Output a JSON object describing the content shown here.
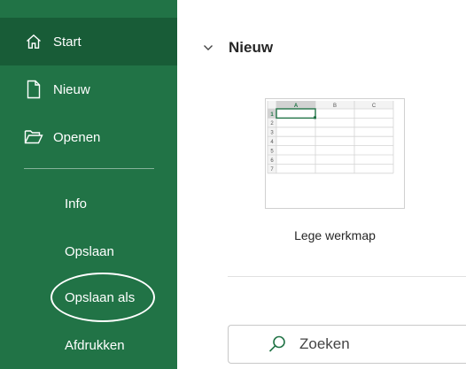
{
  "sidebar": {
    "items": [
      {
        "label": "Start",
        "icon": "home-icon"
      },
      {
        "label": "Nieuw",
        "icon": "new-document-icon"
      },
      {
        "label": "Openen",
        "icon": "open-folder-icon"
      },
      {
        "label": "Info"
      },
      {
        "label": "Opslaan"
      },
      {
        "label": "Opslaan als"
      },
      {
        "label": "Afdrukken"
      }
    ],
    "active": "Start"
  },
  "main": {
    "section_title": "Nieuw",
    "template": {
      "label": "Lege werkmap",
      "columns": [
        "A",
        "B",
        "C"
      ],
      "rows": [
        "1",
        "2",
        "3",
        "4",
        "5",
        "6",
        "7"
      ]
    },
    "search": {
      "placeholder": "Zoeken"
    }
  },
  "colors": {
    "sidebar": "#217346",
    "sidebar_active": "#185c37",
    "accent": "#217346"
  }
}
